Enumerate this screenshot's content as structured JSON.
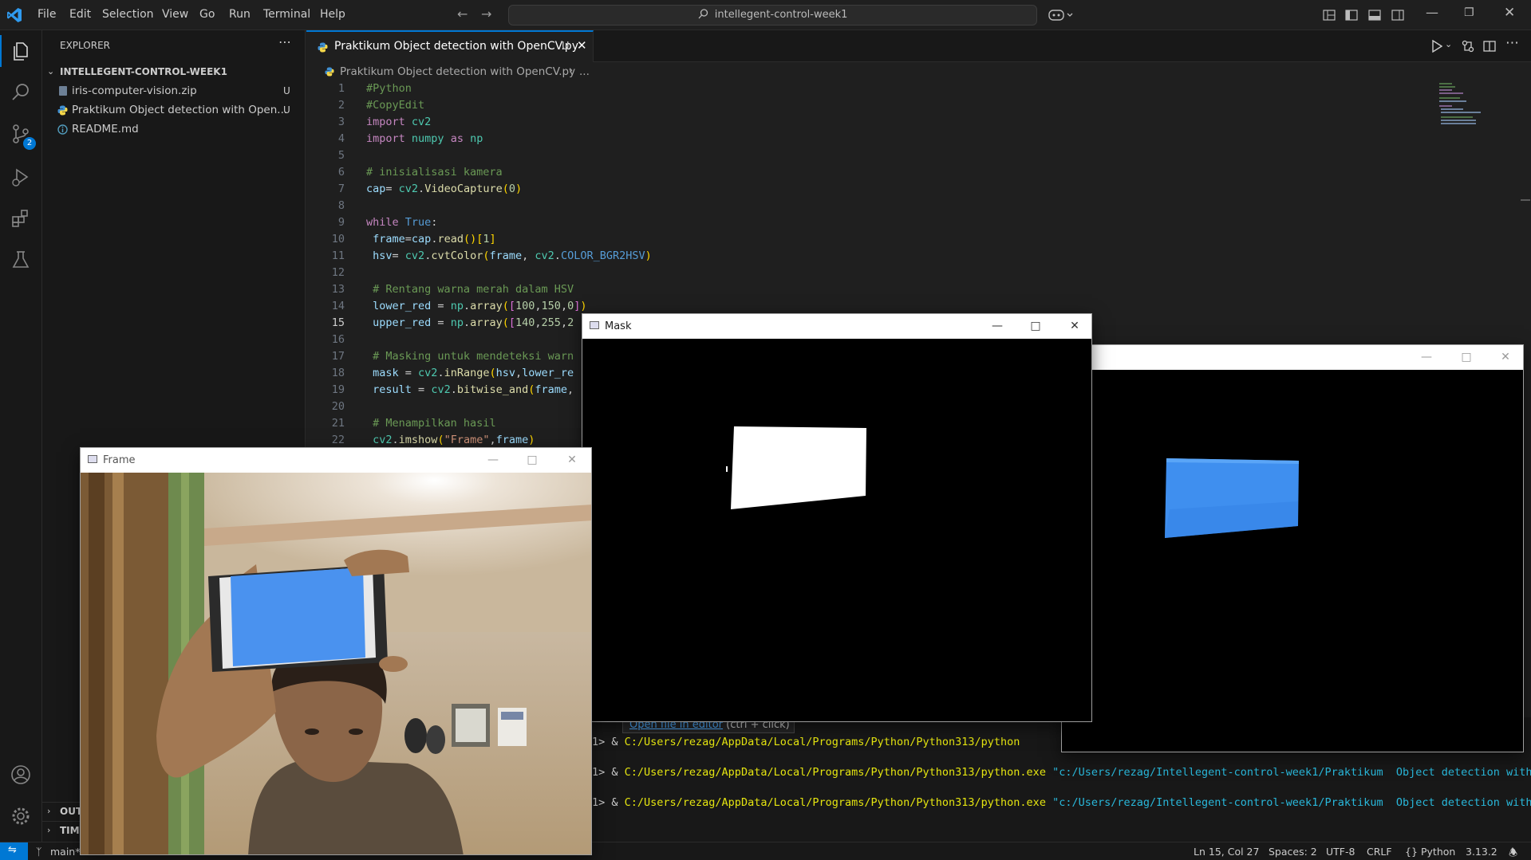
{
  "titlebar": {
    "menus": [
      "File",
      "Edit",
      "Selection",
      "View",
      "Go",
      "Run",
      "Terminal",
      "Help"
    ],
    "search_text": "intellegent-control-week1"
  },
  "activity": {
    "scm_badge": "2"
  },
  "sidebar": {
    "header": "EXPLORER",
    "folder": "INTELLEGENT-CONTROL-WEEK1",
    "files": [
      {
        "name": "iris-computer-vision.zip",
        "status": "U",
        "icon": "zip-icon"
      },
      {
        "name": "Praktikum  Object detection with Open...",
        "status": "U",
        "icon": "python-icon"
      },
      {
        "name": "README.md",
        "status": "",
        "icon": "info-icon"
      }
    ],
    "outline_label": "OUT",
    "timeline_label": "TIMI"
  },
  "tab": {
    "title": "Praktikum Object detection with OpenCV.py",
    "status": "U"
  },
  "breadcrumb": {
    "part1": "Praktikum  Object detection with OpenCV.py",
    "more": "..."
  },
  "editor": {
    "line_numbers": [
      "1",
      "2",
      "3",
      "4",
      "5",
      "6",
      "7",
      "8",
      "9",
      "10",
      "11",
      "12",
      "13",
      "14",
      "15",
      "16",
      "17",
      "18",
      "19",
      "20",
      "21",
      "22"
    ],
    "current_line": "15"
  },
  "terminal": {
    "hover_link": "Open file in editor",
    "hover_hint": "(ctrl + click)",
    "lines": [
      {
        "prefix": "1> & ",
        "path": "C:/Users/rezag/AppData/Local/Programs/Python/Python313/python",
        "arg": ""
      },
      {
        "prefix": "1> & ",
        "path": "C:/Users/rezag/AppData/Local/Programs/Python/Python313/python.exe",
        "arg": " \"c:/Users/rezag/Intellegent-control-week1/Praktikum  Object detection with"
      },
      {
        "prefix": "1> & ",
        "path": "C:/Users/rezag/AppData/Local/Programs/Python/Python313/python.exe",
        "arg": " \"c:/Users/rezag/Intellegent-control-week1/Praktikum  Object detection with"
      }
    ]
  },
  "statusbar": {
    "branch": "main*",
    "position": "Ln 15, Col 27",
    "spaces": "Spaces: 2",
    "encoding": "UTF-8",
    "eol": "CRLF",
    "language": "Python",
    "version": "3.13.2"
  },
  "windows": {
    "mask_title": "Mask",
    "frame_title": "Frame",
    "result_title": ""
  },
  "colors": {
    "accent": "#0078d4",
    "detected_blue": "#3f8fef"
  }
}
